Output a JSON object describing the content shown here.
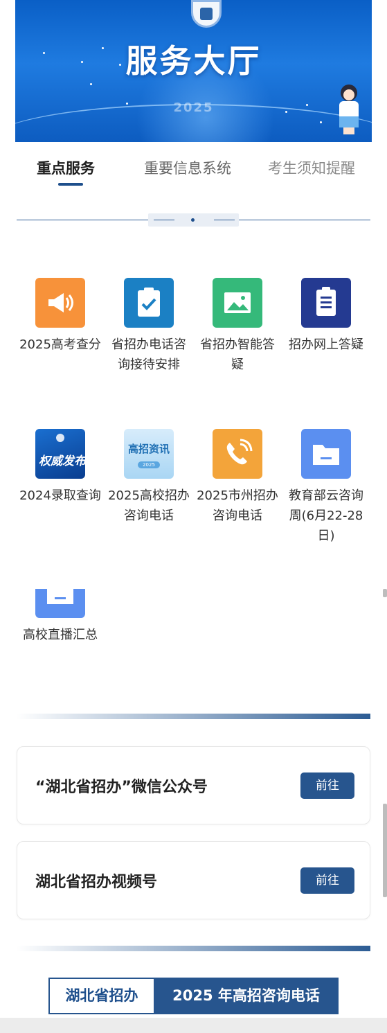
{
  "banner": {
    "title": "服务大厅",
    "year": "2025",
    "logo_icon": "education-seal-icon"
  },
  "tabs": [
    {
      "label": "重点服务",
      "active": true
    },
    {
      "label": "重要信息系统",
      "active": false
    },
    {
      "label": "考生须知提醒",
      "active": false
    }
  ],
  "services": [
    {
      "label": "2025高考查分",
      "icon": "megaphone-icon",
      "color": "#f7923a"
    },
    {
      "label": "省招办电话咨询接待安排",
      "icon": "clipboard-check-icon",
      "color": "#1b80c4"
    },
    {
      "label": "省招办智能答疑",
      "icon": "image-icon",
      "color": "#35b97a"
    },
    {
      "label": "招办网上答疑",
      "icon": "document-icon",
      "color": "#243a91"
    },
    {
      "label": "2024录取查询",
      "icon": "quanwei-fabu-thumbnail",
      "thumb_text": "权威发布",
      "color": "#1a6fd0"
    },
    {
      "label": "2025高校招办咨询电话",
      "icon": "gaozhao-zixun-thumbnail",
      "thumb_text": "高招资讯",
      "thumb_sub": "2025",
      "color": "#a9d6f4"
    },
    {
      "label": "2025市州招办咨询电话",
      "icon": "phone-icon",
      "color": "#f3a43a"
    },
    {
      "label": "教育部云咨询周(6月22-28日)",
      "icon": "folder-icon",
      "color": "#5b8ff0"
    },
    {
      "label": "高校直播汇总",
      "icon": "folder-icon",
      "color": "#5b8ff0"
    }
  ],
  "links": [
    {
      "title": "“湖北省招办”微信公众号",
      "button": "前往"
    },
    {
      "title": "湖北省招办视频号",
      "button": "前往"
    }
  ],
  "footer": {
    "left": "湖北省招办",
    "right": "2025 年高招咨询电话"
  },
  "colors": {
    "brand": "#27558e",
    "banner_blue": "#0a5fc6"
  }
}
